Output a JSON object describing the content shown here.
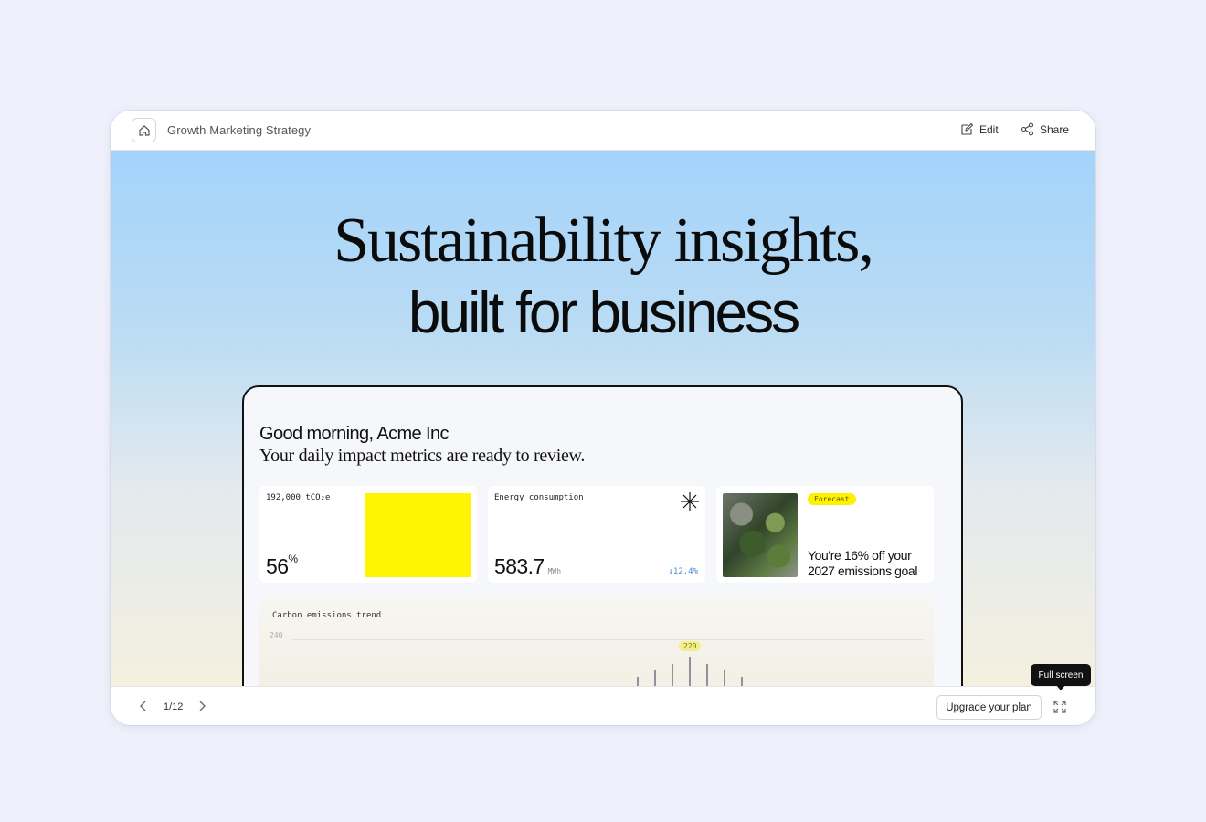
{
  "topbar": {
    "home_icon": "home-icon",
    "title": "Growth Marketing Strategy",
    "edit_label": "Edit",
    "share_label": "Share"
  },
  "slide": {
    "headline_line1": "Sustainability insights,",
    "headline_line2": "built for business",
    "dashboard": {
      "greeting": "Good morning, Acme Inc",
      "subtitle": "Your daily impact metrics are ready to review.",
      "cards": [
        {
          "label": "192,000 tCO₂e",
          "value": "56",
          "value_suffix": "%",
          "accent": "#fff500"
        },
        {
          "label": "Energy consumption",
          "value": "583.7",
          "unit": "MWh",
          "delta": "↓12.4%"
        },
        {
          "badge": "Forecast",
          "text": "You're 16% off your 2027 emissions goal"
        }
      ],
      "trend": {
        "title": "Carbon emissions trend",
        "tick_label": "240",
        "peak_label": "220",
        "bar_levels": [
          0.35,
          0.55,
          0.75,
          1.0,
          0.75,
          0.55,
          0.35
        ]
      }
    }
  },
  "bottombar": {
    "page_indicator": "1/12",
    "upgrade_label": "Upgrade your plan",
    "fullscreen_tooltip": "Full screen"
  }
}
